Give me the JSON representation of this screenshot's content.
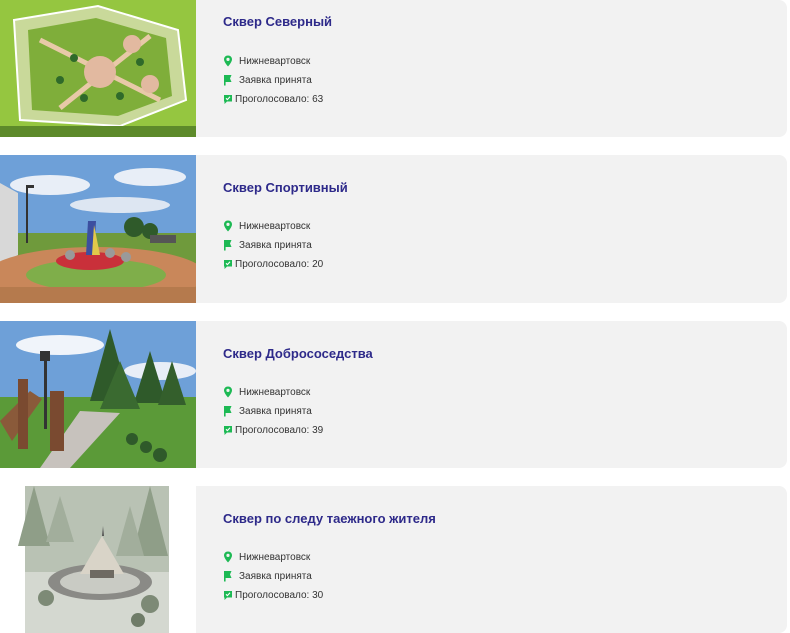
{
  "projects": [
    {
      "title": "Сквер Северный",
      "city": "Нижневартовск",
      "status": "Заявка принята",
      "votes_label": "Проголосовало: 63"
    },
    {
      "title": "Сквер Спортивный",
      "city": "Нижневартовск",
      "status": "Заявка принята",
      "votes_label": "Проголосовало: 20"
    },
    {
      "title": "Сквер Добрососедства",
      "city": "Нижневартовск",
      "status": "Заявка принята",
      "votes_label": "Проголосовало: 39"
    },
    {
      "title": "Сквер по следу таежного жителя",
      "city": "Нижневартовск",
      "status": "Заявка принята",
      "votes_label": "Проголосовало: 30"
    }
  ],
  "icons": {
    "location": "location-pin-icon",
    "status": "flag-icon",
    "votes": "vote-chat-icon"
  },
  "colors": {
    "title": "#2e2a8a",
    "icon_green": "#1db954",
    "card_bg": "#f2f2f2"
  }
}
